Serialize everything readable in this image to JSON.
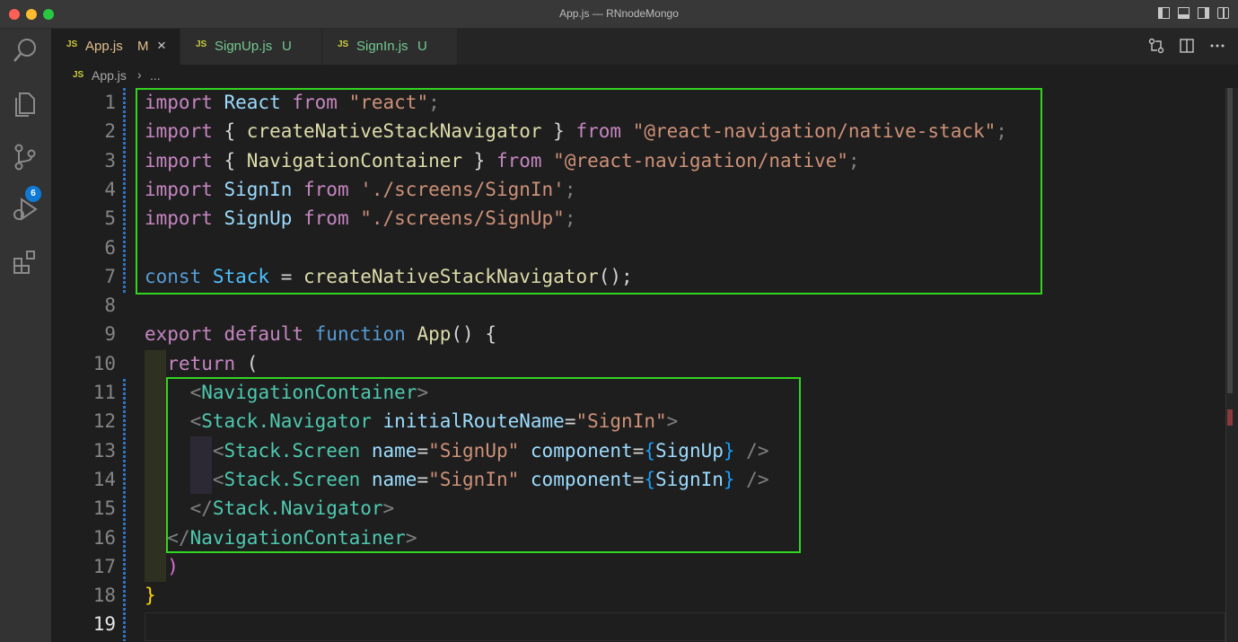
{
  "window": {
    "title": "App.js — RNnodeMongo"
  },
  "tabs": [
    {
      "label": "App.js",
      "status": "M"
    },
    {
      "label": "SignUp.js",
      "status": "U"
    },
    {
      "label": "SignIn.js",
      "status": "U"
    }
  ],
  "breadcrumb": {
    "file": "App.js",
    "more": "..."
  },
  "activity": {
    "badge": "6",
    "icons": [
      "explorer-search-icon",
      "files-icon",
      "source-control-icon",
      "run-debug-icon",
      "extensions-icon"
    ]
  },
  "code": {
    "current_line": "19",
    "lines": [
      {
        "n": "1",
        "t": [
          "import",
          " React ",
          "from",
          " \"react\"",
          ";"
        ]
      },
      {
        "n": "2",
        "t": [
          "import",
          " { ",
          "createNativeStackNavigator",
          " } ",
          "from",
          " \"@react-navigation/native-stack\"",
          ";"
        ]
      },
      {
        "n": "3",
        "t": [
          "import",
          " { ",
          "NavigationContainer",
          " } ",
          "from",
          " \"@react-navigation/native\"",
          ";"
        ]
      },
      {
        "n": "4",
        "t": [
          "import",
          " SignIn ",
          "from",
          " './screens/SignIn'",
          ";"
        ]
      },
      {
        "n": "5",
        "t": [
          "import",
          " SignUp ",
          "from",
          " \"./screens/SignUp\"",
          ";"
        ]
      },
      {
        "n": "6",
        "t": []
      },
      {
        "n": "7",
        "t": [
          "const",
          " Stack",
          " = ",
          "createNativeStackNavigator",
          "();"
        ]
      },
      {
        "n": "8",
        "t": []
      },
      {
        "n": "9",
        "t": [
          "export",
          " default",
          " function",
          " App",
          "() {"
        ]
      },
      {
        "n": "10",
        "t": [
          "  ",
          "return",
          " ("
        ]
      },
      {
        "n": "11",
        "t": [
          "    ",
          "<",
          "NavigationContainer",
          ">"
        ]
      },
      {
        "n": "12",
        "t": [
          "    ",
          "<",
          "Stack.Navigator",
          " initialRouteName",
          "=",
          "\"SignIn\"",
          ">"
        ]
      },
      {
        "n": "13",
        "t": [
          "      ",
          "<",
          "Stack.Screen",
          " name",
          "=",
          "\"SignUp\"",
          " component",
          "=",
          "{",
          "SignUp",
          "}",
          " />"
        ]
      },
      {
        "n": "14",
        "t": [
          "      ",
          "<",
          "Stack.Screen",
          " name",
          "=",
          "\"SignIn\"",
          " component",
          "=",
          "{",
          "SignIn",
          "}",
          " />"
        ]
      },
      {
        "n": "15",
        "t": [
          "    ",
          "</",
          "Stack.Navigator",
          ">"
        ]
      },
      {
        "n": "16",
        "t": [
          "  ",
          "</",
          "NavigationContainer",
          ">"
        ]
      },
      {
        "n": "17",
        "t": [
          "  ",
          ")"
        ]
      },
      {
        "n": "18",
        "t": [
          "}"
        ]
      },
      {
        "n": "19",
        "t": []
      }
    ]
  },
  "colors": {
    "highlight_box": "#32d51f",
    "accent": "#0e7ad6"
  }
}
